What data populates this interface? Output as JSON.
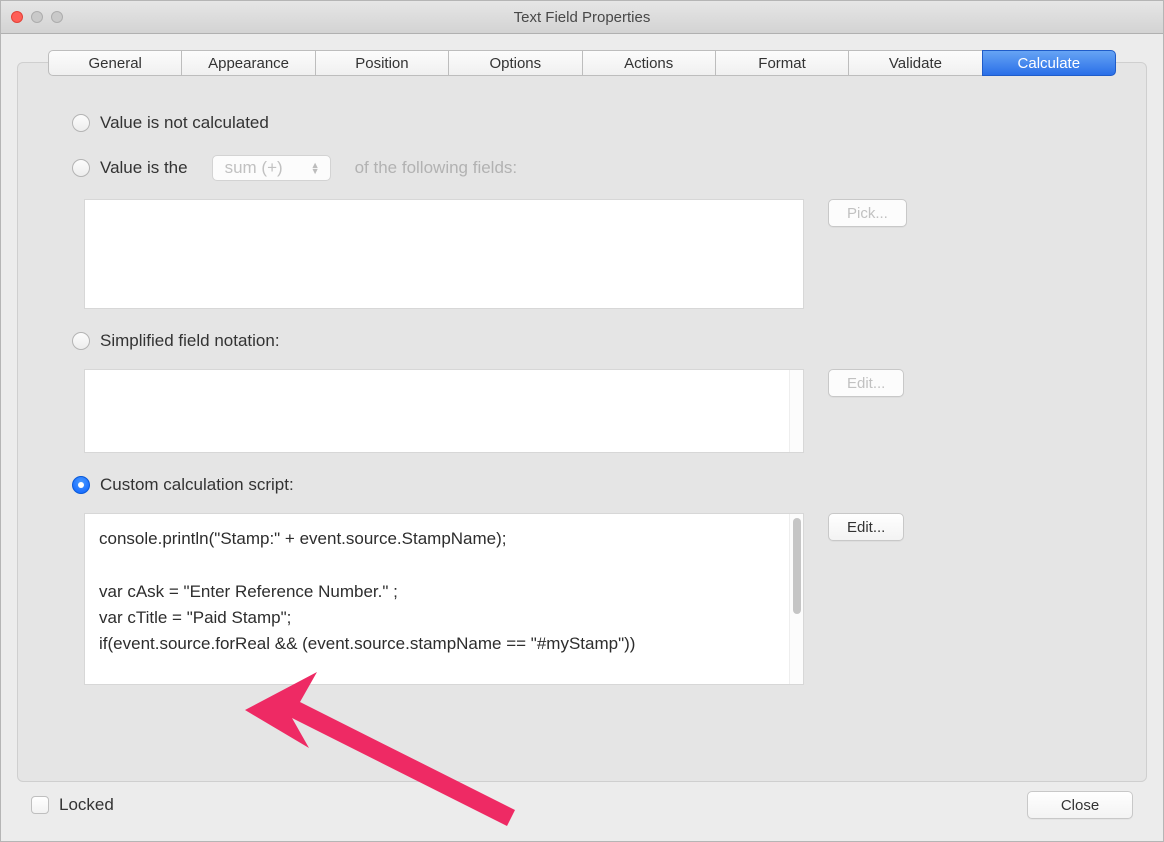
{
  "window": {
    "title": "Text Field Properties"
  },
  "tabs": {
    "general": "General",
    "appearance": "Appearance",
    "position": "Position",
    "options": "Options",
    "actions": "Actions",
    "format": "Format",
    "validate": "Validate",
    "calculate": "Calculate",
    "active": "calculate"
  },
  "calc": {
    "opt_not_calculated": "Value is not calculated",
    "opt_value_is_the": "Value is the",
    "select_sum": "sum (+)",
    "of_following": "of the following fields:",
    "pick_btn": "Pick...",
    "opt_simplified": "Simplified field notation:",
    "edit_btn_simpl": "Edit...",
    "opt_custom": "Custom calculation script:",
    "edit_btn_custom": "Edit...",
    "script": "console.println(\"Stamp:\" + event.source.StampName);\n\nvar cAsk = \"Enter Reference Number.\" ;\nvar cTitle = \"Paid Stamp\";\nif(event.source.forReal && (event.source.stampName == \"#myStamp\"))",
    "selected": "custom"
  },
  "footer": {
    "locked_label": "Locked",
    "close_label": "Close"
  }
}
